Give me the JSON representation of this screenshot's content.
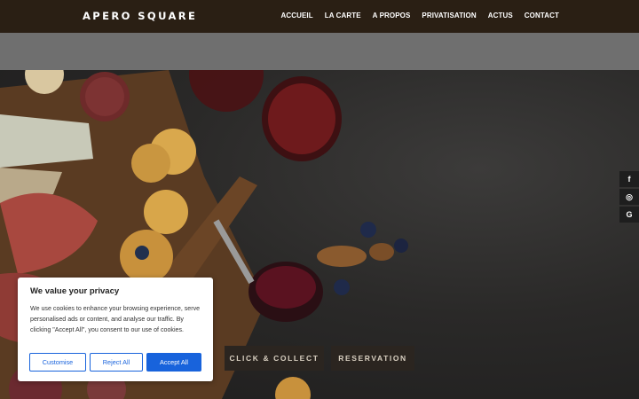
{
  "header": {
    "logo": "APERO SQUARE",
    "nav": [
      "ACCUEIL",
      "LA CARTE",
      "A PROPOS",
      "PRIVATISATION",
      "ACTUS",
      "CONTACT"
    ]
  },
  "social": {
    "icons": [
      "f",
      "◎",
      "G"
    ]
  },
  "hero": {
    "click_collect": "CLICK & COLLECT",
    "reservation": "RESERVATION"
  },
  "cookie": {
    "title": "We value your privacy",
    "text": "We use cookies to enhance your browsing experience, serve personalised ads or content, and analyse our traffic. By clicking \"Accept All\", you consent to our use of cookies.",
    "customise": "Customise",
    "reject": "Reject All",
    "accept": "Accept All"
  },
  "colors": {
    "accent": "#1863dc",
    "header_bg": "#2a1f14"
  }
}
